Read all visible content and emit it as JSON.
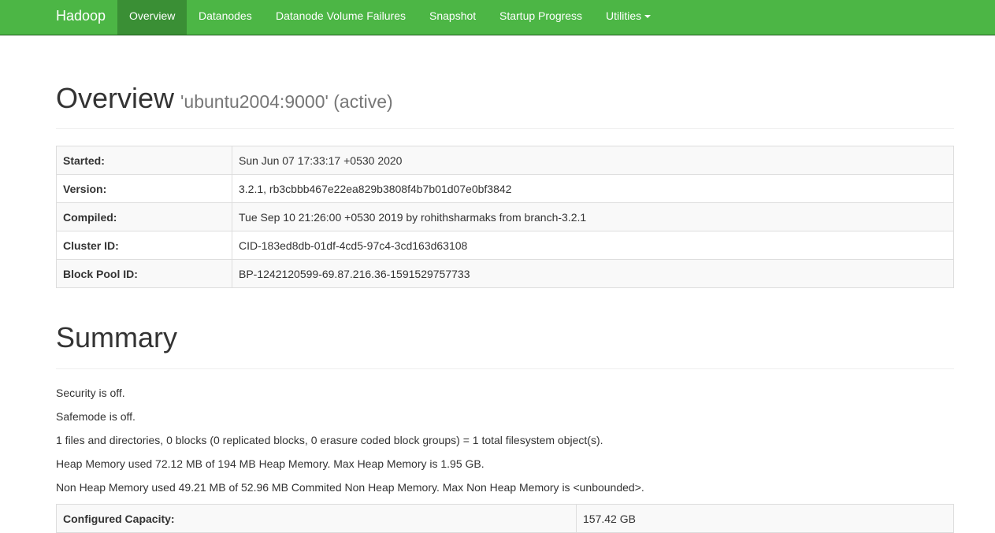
{
  "navbar": {
    "brand": "Hadoop",
    "items": [
      {
        "label": "Overview",
        "active": true
      },
      {
        "label": "Datanodes"
      },
      {
        "label": "Datanode Volume Failures"
      },
      {
        "label": "Snapshot"
      },
      {
        "label": "Startup Progress"
      },
      {
        "label": "Utilities"
      }
    ],
    "colors": {
      "background": "#4cb645",
      "active": "#3a8f35"
    }
  },
  "overview": {
    "title": "Overview",
    "subtitle": "'ubuntu2004:9000' (active)",
    "rows": [
      {
        "key": "Started:",
        "value": "Sun Jun 07 17:33:17 +0530 2020"
      },
      {
        "key": "Version:",
        "value": "3.2.1, rb3cbbb467e22ea829b3808f4b7b01d07e0bf3842"
      },
      {
        "key": "Compiled:",
        "value": "Tue Sep 10 21:26:00 +0530 2019 by rohithsharmaks from branch-3.2.1"
      },
      {
        "key": "Cluster ID:",
        "value": "CID-183ed8db-01df-4cd5-97c4-3cd163d63108"
      },
      {
        "key": "Block Pool ID:",
        "value": "BP-1242120599-69.87.216.36-1591529757733"
      }
    ]
  },
  "summary": {
    "title": "Summary",
    "lines": [
      "Security is off.",
      "Safemode is off.",
      "1 files and directories, 0 blocks (0 replicated blocks, 0 erasure coded block groups) = 1 total filesystem object(s).",
      "Heap Memory used 72.12 MB of 194 MB Heap Memory. Max Heap Memory is 1.95 GB.",
      "Non Heap Memory used 49.21 MB of 52.96 MB Commited Non Heap Memory. Max Non Heap Memory is <unbounded>."
    ],
    "rows": [
      {
        "key": "Configured Capacity:",
        "value": "157.42 GB"
      }
    ]
  }
}
